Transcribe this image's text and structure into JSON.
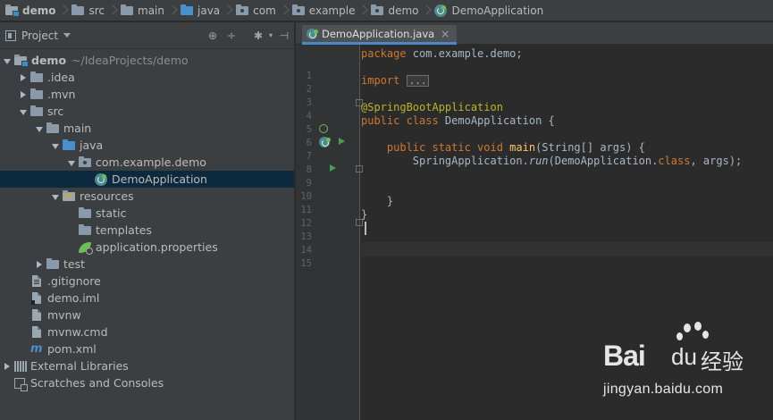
{
  "breadcrumb": [
    {
      "label": "demo",
      "icon": "module-folder-icon"
    },
    {
      "label": "src",
      "icon": "folder-icon"
    },
    {
      "label": "main",
      "icon": "folder-icon"
    },
    {
      "label": "java",
      "icon": "source-folder-icon"
    },
    {
      "label": "com",
      "icon": "package-icon"
    },
    {
      "label": "example",
      "icon": "package-icon"
    },
    {
      "label": "demo",
      "icon": "package-icon"
    },
    {
      "label": "DemoApplication",
      "icon": "spring-boot-class-icon"
    }
  ],
  "project_panel": {
    "title": "Project",
    "header_icons": [
      "locate-icon",
      "collapse-all-icon",
      "settings-icon",
      "hide-panel-icon"
    ],
    "tree": [
      {
        "label": "demo",
        "path": "~/IdeaProjects/demo",
        "depth": 0,
        "arrow": "down",
        "icon": "module",
        "bold": true
      },
      {
        "label": ".idea",
        "depth": 1,
        "arrow": "right",
        "icon": "folder"
      },
      {
        "label": ".mvn",
        "depth": 1,
        "arrow": "right",
        "icon": "folder"
      },
      {
        "label": "src",
        "depth": 1,
        "arrow": "down",
        "icon": "folder"
      },
      {
        "label": "main",
        "depth": 2,
        "arrow": "down",
        "icon": "folder"
      },
      {
        "label": "java",
        "depth": 3,
        "arrow": "down",
        "icon": "source"
      },
      {
        "label": "com.example.demo",
        "depth": 4,
        "arrow": "down",
        "icon": "package"
      },
      {
        "label": "DemoApplication",
        "depth": 5,
        "arrow": "none",
        "icon": "spring",
        "selected": true
      },
      {
        "label": "resources",
        "depth": 3,
        "arrow": "down",
        "icon": "resources"
      },
      {
        "label": "static",
        "depth": 4,
        "arrow": "none",
        "icon": "folder"
      },
      {
        "label": "templates",
        "depth": 4,
        "arrow": "none",
        "icon": "folder"
      },
      {
        "label": "application.properties",
        "depth": 4,
        "arrow": "none",
        "icon": "properties"
      },
      {
        "label": "test",
        "depth": 2,
        "arrow": "right",
        "icon": "folder"
      },
      {
        "label": ".gitignore",
        "depth": 1,
        "arrow": "none",
        "icon": "text"
      },
      {
        "label": "demo.iml",
        "depth": 1,
        "arrow": "none",
        "icon": "iml"
      },
      {
        "label": "mvnw",
        "depth": 1,
        "arrow": "none",
        "icon": "script"
      },
      {
        "label": "mvnw.cmd",
        "depth": 1,
        "arrow": "none",
        "icon": "script"
      },
      {
        "label": "pom.xml",
        "depth": 1,
        "arrow": "none",
        "icon": "maven"
      },
      {
        "label": "External Libraries",
        "depth": 0,
        "arrow": "right",
        "icon": "libraries"
      },
      {
        "label": "Scratches and Consoles",
        "depth": 0,
        "arrow": "none",
        "icon": "scratches"
      }
    ]
  },
  "editor": {
    "tab": {
      "label": "DemoApplication.java",
      "close": "×"
    },
    "line_numbers": [
      "1",
      "2",
      "3",
      "4",
      "5",
      "6",
      "7",
      "8",
      "9",
      "10",
      "11",
      "12",
      "13",
      "14",
      "15"
    ],
    "code": {
      "l1_kw": "package",
      "l1_rest": " com.example.demo;",
      "l3_kw": "import",
      "l3_fold": "...",
      "l6_ann": "@SpringBootApplication",
      "l7_kw": "public class",
      "l7_rest": " DemoApplication {",
      "l9_indent": "    ",
      "l9_kw": "public static void",
      "l9_fn": " main",
      "l9_rest": "(String[] args) {",
      "l10_indent": "        ",
      "l10_a": "SpringApplication.",
      "l10_run": "run",
      "l10_b": "(DemoApplication.",
      "l10_kw": "class",
      "l10_c": ", args);",
      "l13_text": "    }",
      "l14_text": "}"
    }
  },
  "watermark": {
    "bai": "Bai",
    "du": "du",
    "jingyan": "经验",
    "url": "jingyan.baidu.com"
  },
  "colors": {
    "keyword": "#cc7832",
    "annotation": "#bbb529",
    "method": "#ffc66d",
    "selection": "#0d293e",
    "tab_accent": "#4a88c7"
  }
}
